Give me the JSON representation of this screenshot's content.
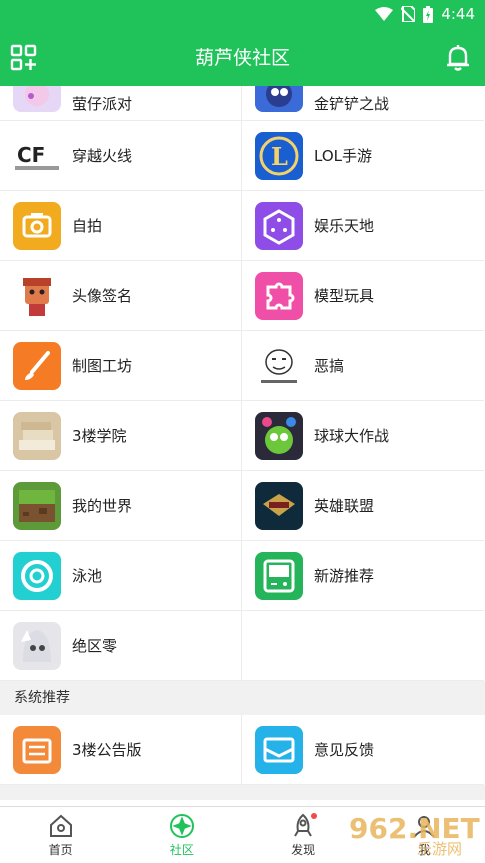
{
  "status": {
    "time": "4:44"
  },
  "header": {
    "title": "葫芦侠社区",
    "left_icon": "grid-add-icon",
    "right_icon": "bell-icon"
  },
  "grid_items": [
    {
      "label": "萤仔派对",
      "icon": "party-game-icon",
      "color": "#e7d7f7"
    },
    {
      "label": "金铲铲之战",
      "icon": "golden-spatula-game-icon",
      "color": "#3b6bd8"
    },
    {
      "label": "穿越火线",
      "icon": "crossfire-icon",
      "color": "#ffffff"
    },
    {
      "label": "LOL手游",
      "icon": "lol-mobile-icon",
      "color": "#1a5fd2"
    },
    {
      "label": "自拍",
      "icon": "camera-icon",
      "color": "#f2ab1f"
    },
    {
      "label": "娱乐天地",
      "icon": "dice-icon",
      "color": "#8d4de6"
    },
    {
      "label": "头像签名",
      "icon": "avatar-character-icon",
      "color": "#ffffff"
    },
    {
      "label": "模型玩具",
      "icon": "puzzle-icon",
      "color": "#f04fa8"
    },
    {
      "label": "制图工坊",
      "icon": "brush-icon",
      "color": "#f57b25"
    },
    {
      "label": "恶搞",
      "icon": "meme-face-icon",
      "color": "#ffffff"
    },
    {
      "label": "3楼学院",
      "icon": "books-icon",
      "color": "#d8c6a5"
    },
    {
      "label": "球球大作战",
      "icon": "ball-battle-icon",
      "color": "#2a2a3a"
    },
    {
      "label": "我的世界",
      "icon": "minecraft-icon",
      "color": "#5c9a3a"
    },
    {
      "label": "英雄联盟",
      "icon": "league-icon",
      "color": "#0f2a3a"
    },
    {
      "label": "泳池",
      "icon": "lifebuoy-icon",
      "color": "#22cfd1"
    },
    {
      "label": "新游推荐",
      "icon": "gamepad-new-icon",
      "color": "#25b45a"
    },
    {
      "label": "绝区零",
      "icon": "zenless-icon",
      "color": "#e6e6ea"
    }
  ],
  "section": {
    "title": "系统推荐"
  },
  "recommend_items": [
    {
      "label": "3楼公告版",
      "icon": "notice-board-icon",
      "color": "#f38a3a"
    },
    {
      "label": "意见反馈",
      "icon": "envelope-icon",
      "color": "#25b2e8"
    }
  ],
  "tabs": [
    {
      "label": "首页",
      "icon": "home-icon",
      "active": false
    },
    {
      "label": "社区",
      "icon": "community-icon",
      "active": true
    },
    {
      "label": "发现",
      "icon": "rocket-icon",
      "active": false
    },
    {
      "label": "我",
      "icon": "profile-icon",
      "active": false
    }
  ],
  "watermark": {
    "text": "962.NET",
    "subtext": "乐游网"
  },
  "colors": {
    "primary": "#1fc35a",
    "divider": "#ececec",
    "section_bg": "#f1f1f1"
  }
}
